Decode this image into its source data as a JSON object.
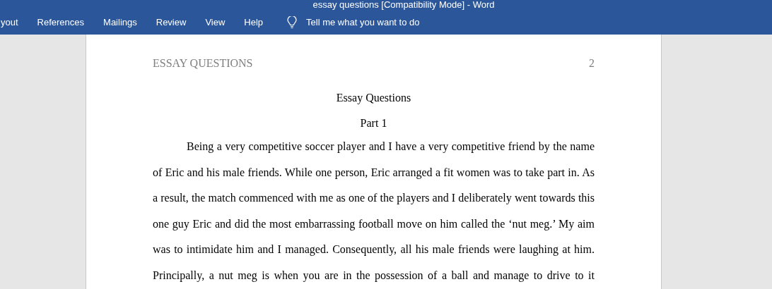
{
  "window": {
    "title": "essay questions [Compatibility Mode]  -  Word"
  },
  "tabs": [
    {
      "label": "yout"
    },
    {
      "label": "References"
    },
    {
      "label": "Mailings"
    },
    {
      "label": "Review"
    },
    {
      "label": "View"
    },
    {
      "label": "Help"
    }
  ],
  "tell_me": {
    "placeholder": "Tell me what you want to do"
  },
  "document": {
    "header": {
      "running_head": "ESSAY QUESTIONS",
      "page_number": "2"
    },
    "title": "Essay Questions",
    "subtitle": "Part 1",
    "paragraph": "Being a very competitive soccer player and I have a very competitive friend by the name of Eric and his male friends. While one person, Eric arranged a fit women was to take part in. As a result, the match commenced with me as one of the players and I deliberately went towards this one guy Eric and did the most embarrassing football move on him called the ‘nut meg.’ My aim was to intimidate him and I managed. Consequently, all his male friends were laughing at him. Principally, a nut meg is when you are in the possession of a ball and manage to drive to it"
  }
}
